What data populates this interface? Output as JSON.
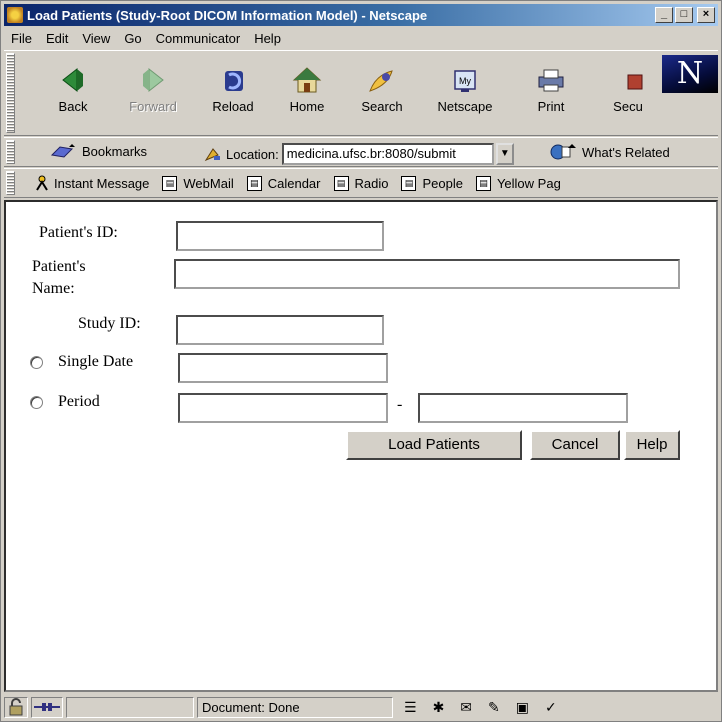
{
  "window": {
    "title": "Load Patients (Study-Root DICOM Information Model) - Netscape",
    "controls": {
      "minimize": "_",
      "maximize": "□",
      "close": "×"
    }
  },
  "menubar": [
    {
      "label": "File"
    },
    {
      "label": "Edit"
    },
    {
      "label": "View"
    },
    {
      "label": "Go"
    },
    {
      "label": "Communicator"
    },
    {
      "label": "Help"
    }
  ],
  "nav_toolbar": {
    "buttons": [
      {
        "label": "Back",
        "icon": "back-arrow-icon"
      },
      {
        "label": "Forward",
        "icon": "forward-arrow-icon",
        "disabled": true
      },
      {
        "label": "Reload",
        "icon": "reload-icon"
      },
      {
        "label": "Home",
        "icon": "home-icon"
      },
      {
        "label": "Search",
        "icon": "search-icon"
      },
      {
        "label": "Netscape",
        "icon": "my-netscape-icon"
      },
      {
        "label": "Print",
        "icon": "print-icon"
      },
      {
        "label": "Secu",
        "icon": "security-icon"
      }
    ],
    "logo": "N"
  },
  "location_toolbar": {
    "bookmarks_label": "Bookmarks",
    "location_label": "Location:",
    "url": "medicina.ufsc.br:8080/submit",
    "related_label": "What's Related"
  },
  "personal_toolbar": [
    {
      "label": "Instant Message"
    },
    {
      "label": "WebMail"
    },
    {
      "label": "Calendar"
    },
    {
      "label": "Radio"
    },
    {
      "label": "People"
    },
    {
      "label": "Yellow Pag"
    }
  ],
  "form": {
    "patient_id_label": "Patient's ID:",
    "patient_id_value": "",
    "patient_name_label_1": "Patient's",
    "patient_name_label_2": "Name:",
    "patient_name_value": "",
    "study_id_label": "Study ID:",
    "study_id_value": "",
    "single_date_label": "Single Date",
    "single_date_value": "",
    "period_label": "Period",
    "period_separator": "-",
    "period_from_value": "",
    "period_to_value": "",
    "load_button": "Load Patients",
    "cancel_button": "Cancel",
    "help_button": "Help"
  },
  "statusbar": {
    "status_text": "Document: Done"
  },
  "colors": {
    "title_gradient_start": "#0a246a",
    "title_gradient_end": "#a6caf0",
    "chrome": "#d4d0c8"
  }
}
